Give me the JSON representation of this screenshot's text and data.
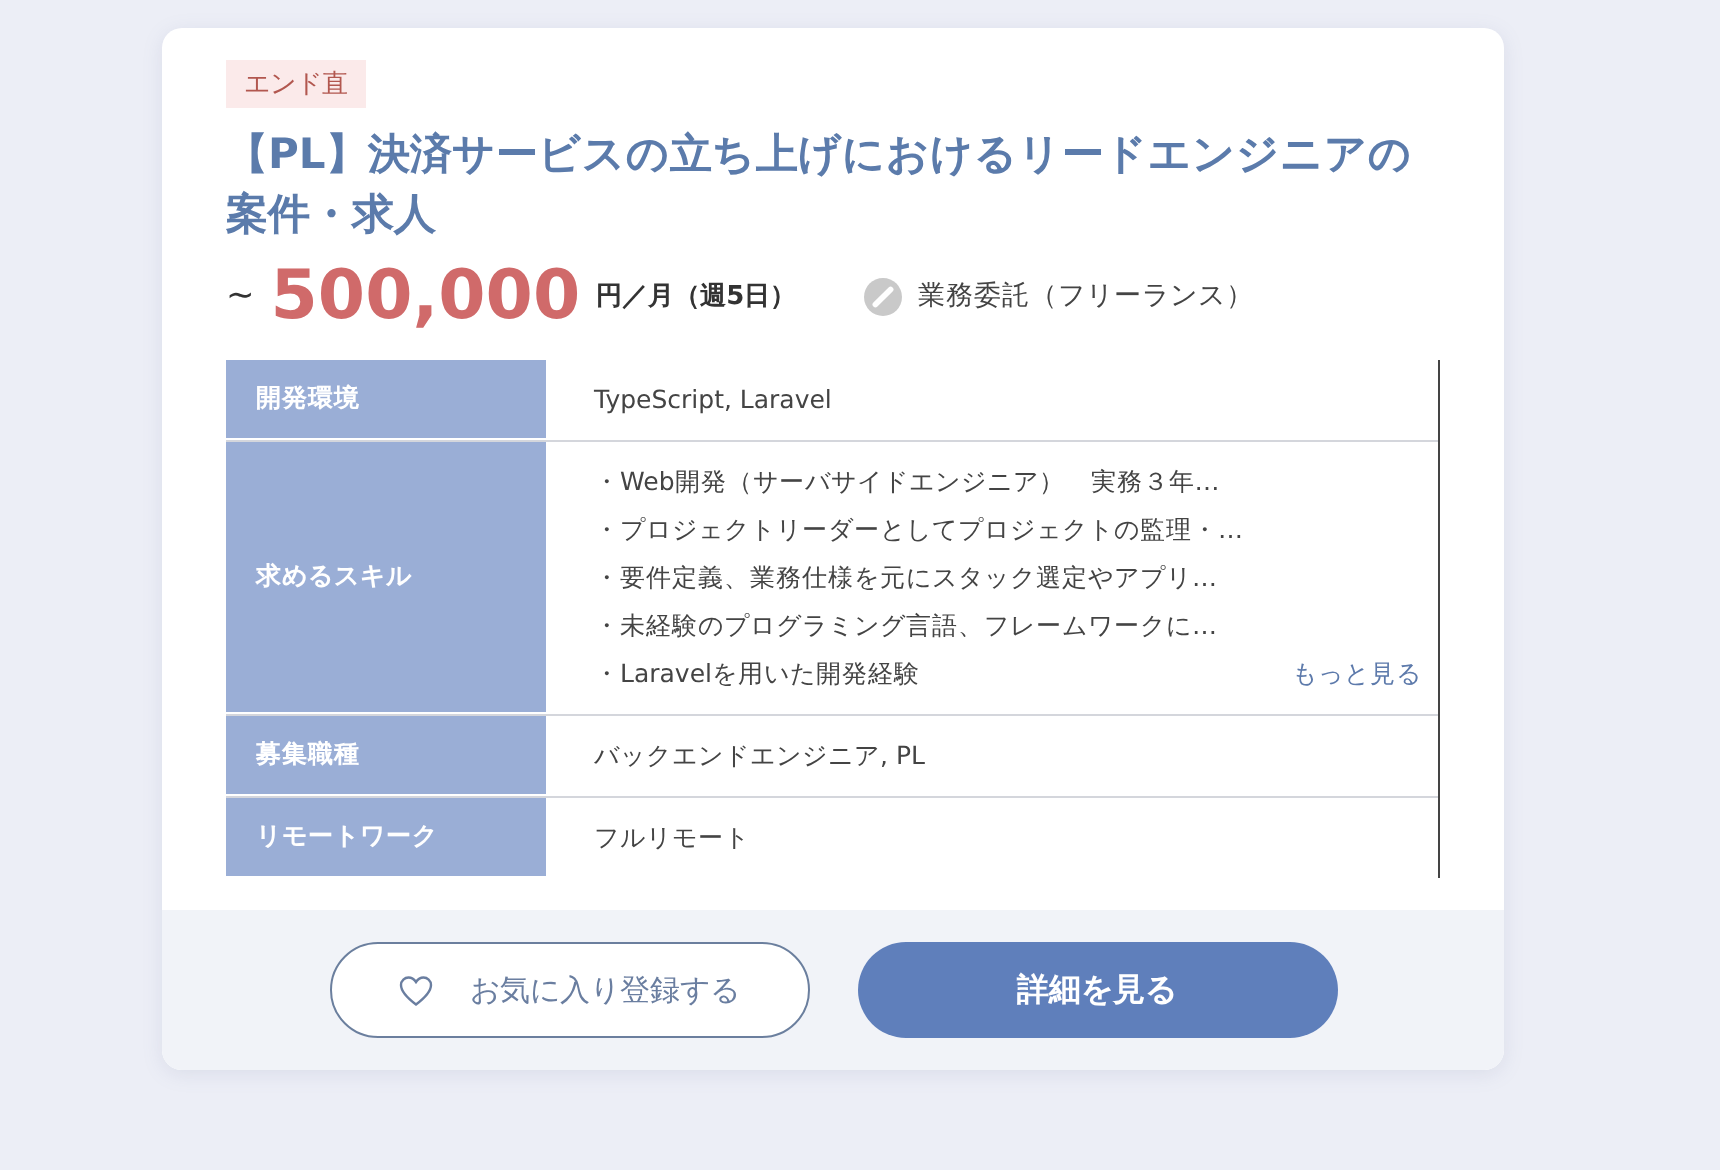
{
  "tag": "エンド直",
  "title": "【PL】決済サービスの立ち上げにおけるリードエンジニアの案件・求人",
  "price": {
    "prefix": "~",
    "amount": "500,000",
    "unit": "円／月（週5日）"
  },
  "contract": "業務委託（フリーランス）",
  "table": [
    {
      "kind": "text",
      "label": "開発環境",
      "value": "TypeScript, Laravel"
    },
    {
      "kind": "list",
      "label": "求めるスキル",
      "items": [
        "・Web開発（サーバサイドエンジニア）　実務３年…",
        "・プロジェクトリーダーとしてプロジェクトの監理・…",
        "・要件定義、業務仕様を元にスタック選定やアプリ…",
        "・未経験のプログラミング言語、フレームワークに…",
        "・Laravelを用いた開発経験"
      ],
      "more": "もっと見る"
    },
    {
      "kind": "text",
      "label": "募集職種",
      "value": "バックエンドエンジニア, PL"
    },
    {
      "kind": "text",
      "label": "リモートワーク",
      "value": "フルリモート"
    }
  ],
  "buttons": {
    "favorite": "お気に入り登録する",
    "detail": "詳細を見る"
  }
}
